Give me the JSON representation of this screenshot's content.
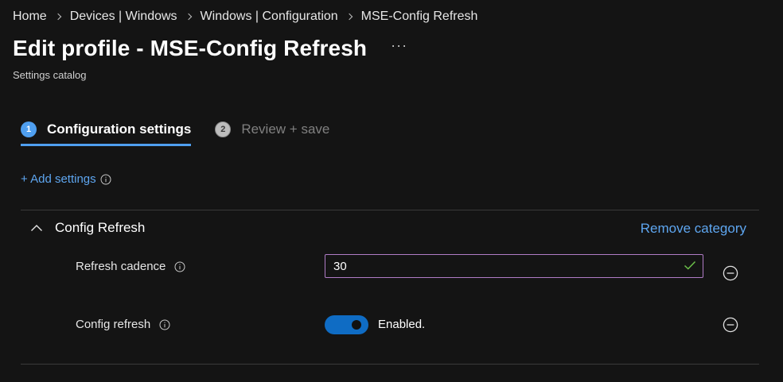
{
  "breadcrumb": {
    "items": [
      "Home",
      "Devices | Windows",
      "Windows | Configuration",
      "MSE-Config Refresh"
    ]
  },
  "header": {
    "title": "Edit profile - MSE-Config Refresh",
    "more_label": "···",
    "subtitle": "Settings catalog"
  },
  "steps": [
    {
      "number": "1",
      "label": "Configuration settings",
      "state": "active"
    },
    {
      "number": "2",
      "label": "Review + save",
      "state": "inactive"
    }
  ],
  "add_settings": {
    "label": "+ Add settings",
    "info_icon": "info-icon"
  },
  "category": {
    "name": "Config Refresh",
    "expand_icon": "chevron-up-icon",
    "remove_label": "Remove category",
    "settings": [
      {
        "label": "Refresh cadence",
        "value": "30",
        "valid": true
      },
      {
        "label": "Config refresh",
        "toggle_state": "on",
        "toggle_text": "Enabled."
      }
    ]
  },
  "colors": {
    "background": "#141414",
    "link": "#5ea6f0",
    "accent": "#4f9ff0",
    "toggle_on": "#0f6cc4",
    "input_border": "#b07cc6",
    "valid_check": "#6cc24a"
  }
}
